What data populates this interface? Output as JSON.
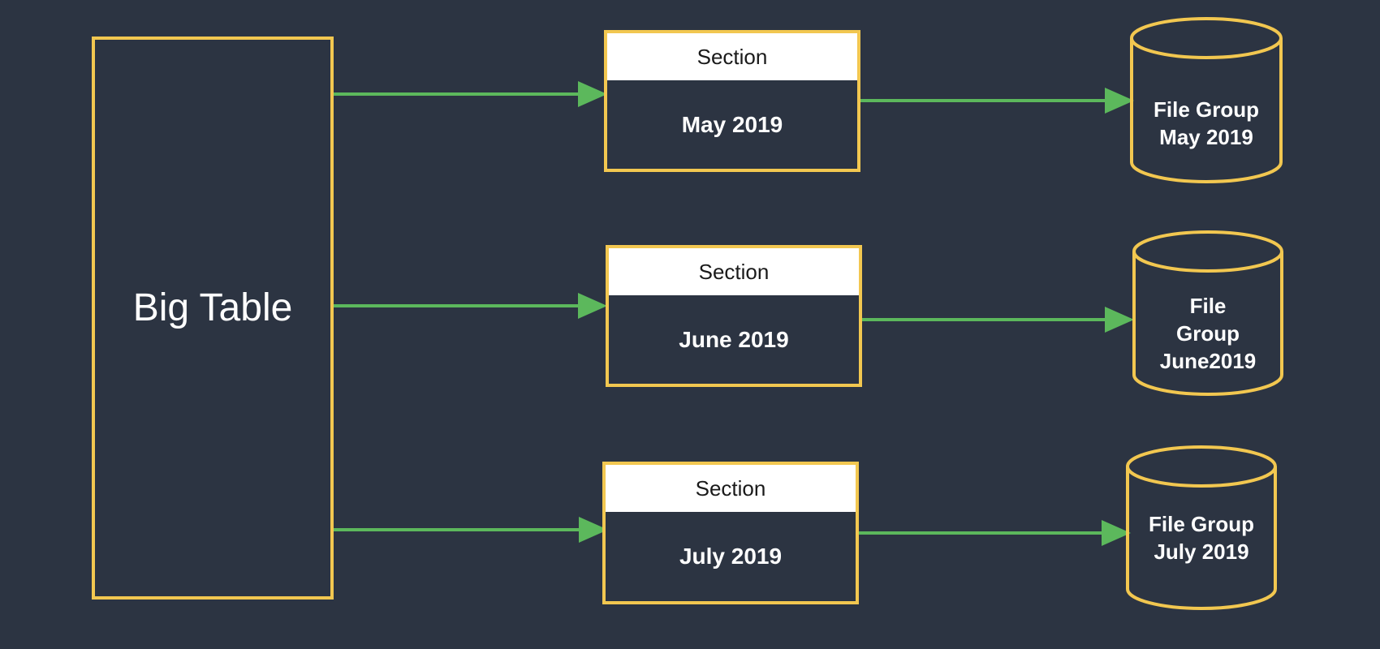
{
  "big_table": {
    "label": "Big Table"
  },
  "sections": [
    {
      "header": "Section",
      "period": "May 2019"
    },
    {
      "header": "Section",
      "period": "June 2019"
    },
    {
      "header": "Section",
      "period": "July 2019"
    }
  ],
  "file_groups": [
    {
      "lines": [
        "File Group",
        "May 2019"
      ]
    },
    {
      "lines": [
        "File",
        "Group",
        "June2019"
      ]
    },
    {
      "lines": [
        "File Group",
        "July 2019"
      ]
    }
  ],
  "colors": {
    "background": "#2c3442",
    "outline": "#f2c750",
    "arrow": "#5cb85c",
    "text": "#ffffff",
    "header_fill": "#ffffff"
  }
}
